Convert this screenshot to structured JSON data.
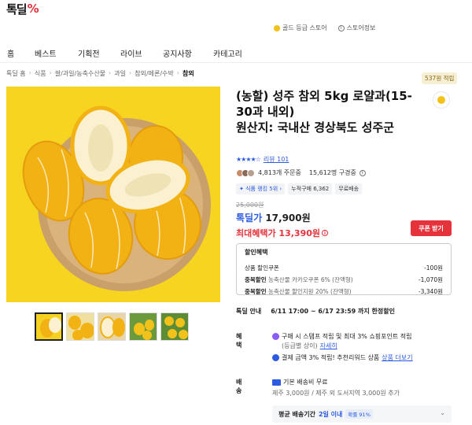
{
  "brand": {
    "logo_text": "톡딜",
    "logo_mark": "%"
  },
  "store_links": {
    "grade": "골드 등급 스토어",
    "store_info": "스토어정보"
  },
  "nav": [
    "홈",
    "베스트",
    "기획전",
    "라이브",
    "공지사항",
    "카테고리"
  ],
  "breadcrumb": [
    "톡딜 홈",
    "식품",
    "쌀/과일/농축수산물",
    "과일",
    "참외/메론/수박",
    "참외"
  ],
  "product": {
    "title": "(농할) 성주 참외 5kg 로얄과(15-30과 내외)\n원산지: 국내산 경상북도 성주군",
    "reward_badge": "537원 적립",
    "rating_stars": "★★★★☆",
    "review_text": "리뷰 101",
    "orders": "4,813개 주문중",
    "subscribers": "15,612명 구경중",
    "tags": [
      "식품 랭킹 5위",
      "누적구매 6,362",
      "무료배송"
    ],
    "original_price": "25,000원",
    "price_label": "톡딜가",
    "price": "17,900원",
    "max_benefit": "최대혜택가 13,390원",
    "coupon_button": "쿠폰 받기"
  },
  "discount": {
    "title": "할인혜택",
    "rows": [
      {
        "label": "상품 할인쿠폰",
        "desc": "",
        "value": "-100원"
      },
      {
        "label": "중복할인",
        "desc": "농축산물 카카오쿠폰 6% (잔액형)",
        "value": "-1,070원"
      },
      {
        "label": "중복할인",
        "desc": "농축산물 할인지원 20% (잔액형)",
        "value": "-3,340원"
      }
    ]
  },
  "sale": {
    "key": "톡딜 안내",
    "value": "6/11 17:00 ~ 6/17 23:59 까지 한정할인"
  },
  "benefit": {
    "key": "혜택",
    "line1": "구매 시 스탬프 적립 및 최대 3% 쇼핑포인트 적립",
    "line1b": "(등급별 상이)",
    "line1_link": "자세히",
    "line2": "결제 금액 3% 적립! 추천리워드 상품",
    "line2_link": "상품 더보기"
  },
  "shipping": {
    "key": "배송",
    "line1": "기본 배송비 무료",
    "line2": "제주 3,000원 / 제주 외 도서지역 3,000원 추가",
    "avg_label": "평균 배송기간",
    "avg_value": "2일 이내",
    "avg_tag": "확률 91%"
  },
  "colors": {
    "accent_red": "#e5323b",
    "accent_blue": "#2c5ae0",
    "image_bg": "#f5d21f"
  }
}
